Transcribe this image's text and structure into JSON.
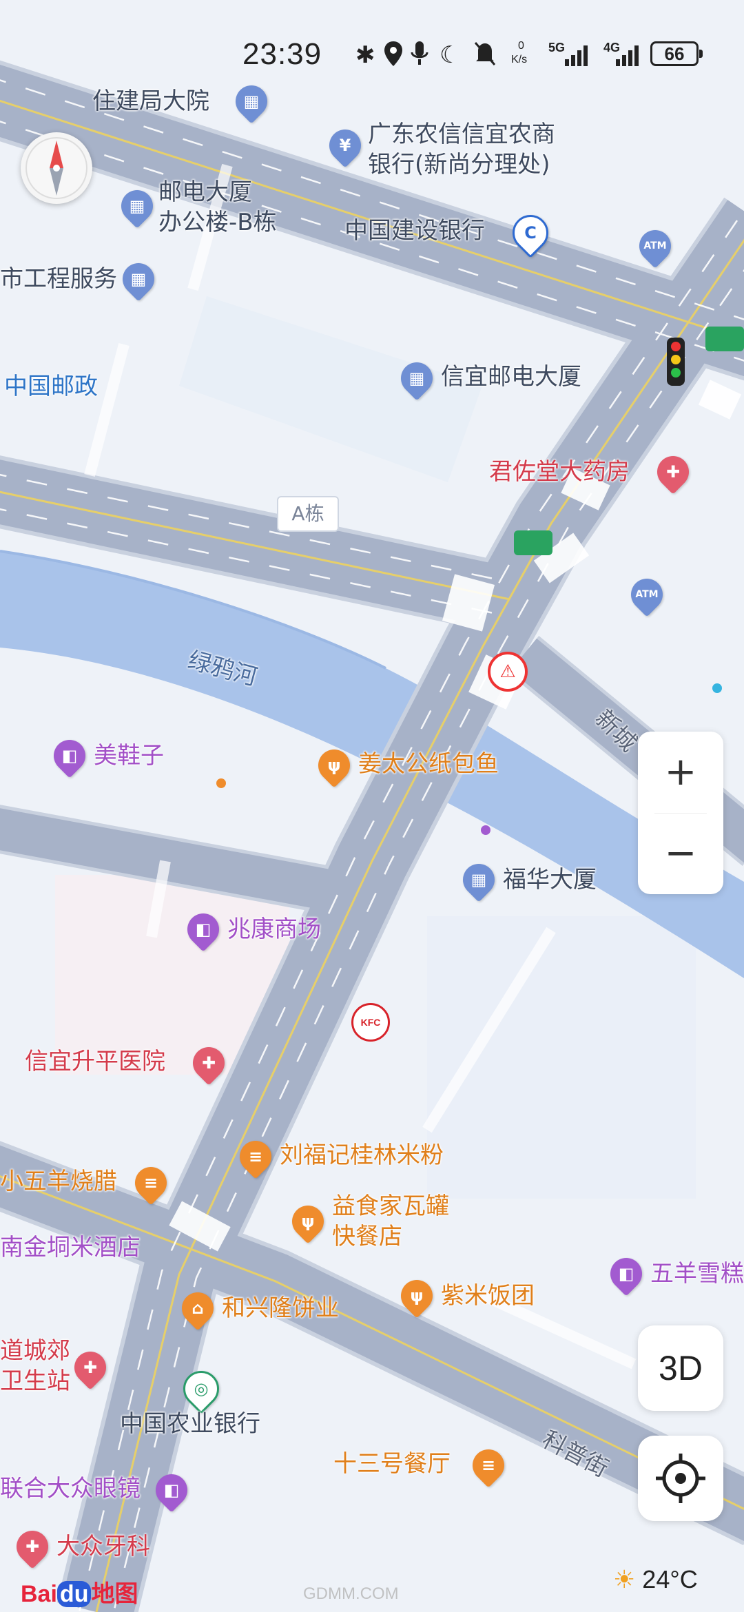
{
  "status_bar": {
    "time": "23:39",
    "network_speed_value": "0",
    "network_speed_unit": "K/s",
    "signal_1": "5G",
    "signal_2": "4G",
    "battery": "66"
  },
  "map": {
    "roads": [
      {
        "name": "科普街"
      },
      {
        "name": "新城"
      }
    ],
    "water": [
      {
        "name": "绿鸦河"
      }
    ],
    "building_tags": [
      {
        "name": "A栋"
      }
    ],
    "pois": [
      {
        "name": "住建局大院",
        "category": "building"
      },
      {
        "name": "广东农信信宜农商",
        "category": "bank"
      },
      {
        "name": "银行(新尚分理处)",
        "category": "bank"
      },
      {
        "name": "邮电大厦",
        "category": "building"
      },
      {
        "name": "办公楼-B栋",
        "category": "building"
      },
      {
        "name": "中国建设银行",
        "category": "bank"
      },
      {
        "name": "市工程服务",
        "category": "building"
      },
      {
        "name": "中国邮政",
        "category": "post"
      },
      {
        "name": "信宜邮电大厦",
        "category": "building"
      },
      {
        "name": "君佐堂大药房",
        "category": "pharmacy"
      },
      {
        "name": "美鞋子",
        "category": "shopping"
      },
      {
        "name": "姜太公纸包鱼",
        "category": "food"
      },
      {
        "name": "福华大厦",
        "category": "building"
      },
      {
        "name": "兆康商场",
        "category": "shopping"
      },
      {
        "name": "信宜升平医院",
        "category": "hospital"
      },
      {
        "name": "刘福记桂林米粉",
        "category": "food"
      },
      {
        "name": "小五羊烧腊",
        "category": "food"
      },
      {
        "name": "益食家瓦罐",
        "category": "food"
      },
      {
        "name": "快餐店",
        "category": "food"
      },
      {
        "name": "南金垌米酒店",
        "category": "shopping"
      },
      {
        "name": "五羊雪糕",
        "category": "shopping"
      },
      {
        "name": "和兴隆饼业",
        "category": "food"
      },
      {
        "name": "紫米饭团",
        "category": "food"
      },
      {
        "name": "道城郊",
        "category": "hospital"
      },
      {
        "name": "卫生站",
        "category": "hospital"
      },
      {
        "name": "中国农业银行",
        "category": "bank"
      },
      {
        "name": "十三号餐厅",
        "category": "food"
      },
      {
        "name": "联合大众眼镜",
        "category": "shopping"
      },
      {
        "name": "大众牙科",
        "category": "hospital"
      }
    ],
    "markers": [
      {
        "name": "KFC"
      },
      {
        "name": "ATM"
      },
      {
        "name": "ATM"
      }
    ]
  },
  "controls": {
    "zoom_in": "+",
    "zoom_out": "−",
    "three_d": "3D"
  },
  "weather": {
    "temperature": "24°C"
  },
  "brand": {
    "logo_text_1": "Bai",
    "logo_text_2": "du",
    "logo_text_3": "地图"
  },
  "watermark": "GDMM.COM"
}
